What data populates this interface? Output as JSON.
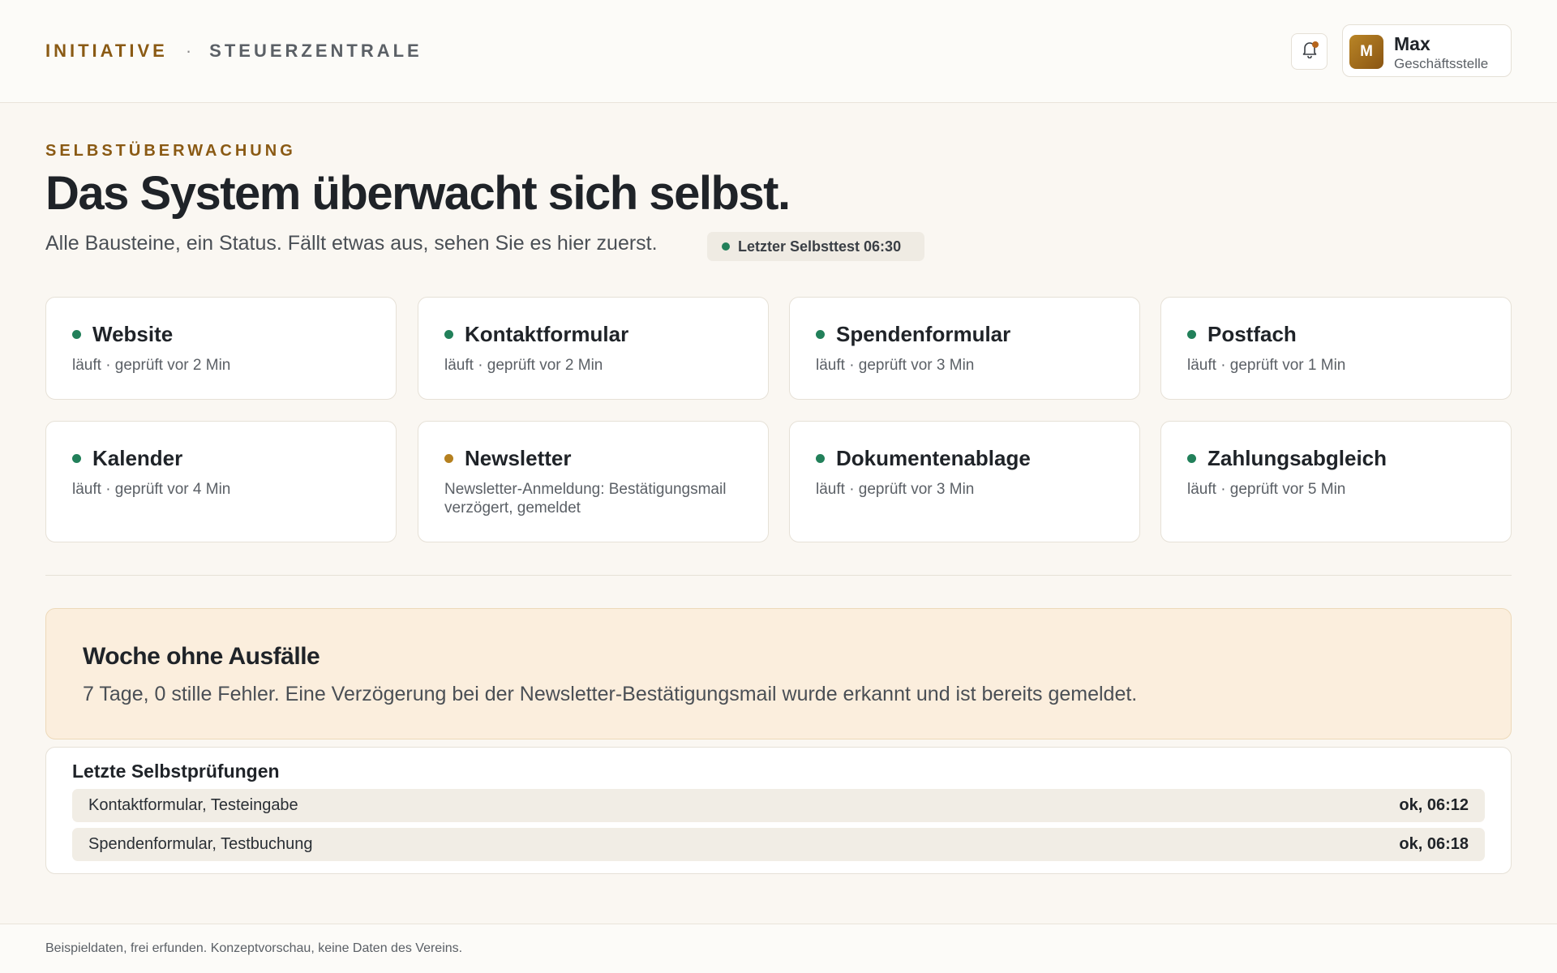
{
  "header": {
    "brand_main": "INITIATIVE",
    "brand_separator": "·",
    "brand_sub": "STEUERZENTRALE",
    "notifications_icon": "bell-icon",
    "user": {
      "initial": "M",
      "name": "Max",
      "role": "Geschäftsstelle"
    }
  },
  "hero": {
    "eyebrow": "SELBSTÜBERWACHUNG",
    "title": "Das System überwacht sich selbst.",
    "subtitle": "Alle Bausteine, ein Status. Fällt etwas aus, sehen Sie es hier zuerst.",
    "last_selftest": "Letzter Selbsttest 06:30"
  },
  "modules": [
    {
      "name": "Website",
      "status": "läuft · geprüft vor 2 Min",
      "state": "ok"
    },
    {
      "name": "Kontaktformular",
      "status": "läuft · geprüft vor 2 Min",
      "state": "ok"
    },
    {
      "name": "Spendenformular",
      "status": "läuft · geprüft vor 3 Min",
      "state": "ok"
    },
    {
      "name": "Postfach",
      "status": "läuft · geprüft vor 1 Min",
      "state": "ok"
    },
    {
      "name": "Kalender",
      "status": "läuft · geprüft vor 4 Min",
      "state": "ok"
    },
    {
      "name": "Newsletter",
      "status": "Newsletter-Anmeldung: Bestätigungsmail verzögert, gemeldet",
      "state": "warning"
    },
    {
      "name": "Dokumentenablage",
      "status": "läuft · geprüft vor 3 Min",
      "state": "ok"
    },
    {
      "name": "Zahlungsabgleich",
      "status": "läuft · geprüft vor 5 Min",
      "state": "ok"
    }
  ],
  "colors": {
    "ok": "#22805a",
    "warning": "#b5801f",
    "accent": "#8a5a14"
  },
  "summary": {
    "title": "Woche ohne Ausfälle",
    "text": "7 Tage, 0 stille Fehler. Eine Verzögerung bei der Newsletter-Bestätigungsmail wurde erkannt und ist bereits gemeldet."
  },
  "checks": {
    "title": "Letzte Selbstprüfungen",
    "rows": [
      {
        "name": "Kontaktformular, Testeingabe",
        "result": "ok, 06:12"
      },
      {
        "name": "Spendenformular, Testbuchung",
        "result": "ok, 06:18"
      }
    ]
  },
  "footer": {
    "text": "Beispieldaten, frei erfunden. Konzeptvorschau, keine Daten des Vereins."
  }
}
